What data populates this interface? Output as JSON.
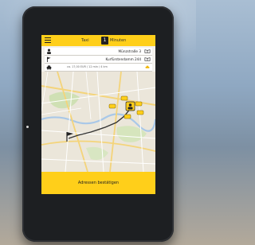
{
  "app_bar": {
    "tab_now": "Taxi",
    "count": "1",
    "tab_minutes": "Minuten"
  },
  "pickup": {
    "address": "Münzstraße 3"
  },
  "destination": {
    "address": "Kurfürstendamm 244"
  },
  "fare": {
    "estimate": "ca. 17,00 EUR / 12 min / 4 km"
  },
  "confirm_button": {
    "label": "Adressen bestätigen"
  },
  "colors": {
    "accent": "#ffcf1a",
    "route": "#333333"
  },
  "icons": [
    "menu-icon",
    "person-icon",
    "flag-icon",
    "taxi-icon",
    "book-icon"
  ]
}
